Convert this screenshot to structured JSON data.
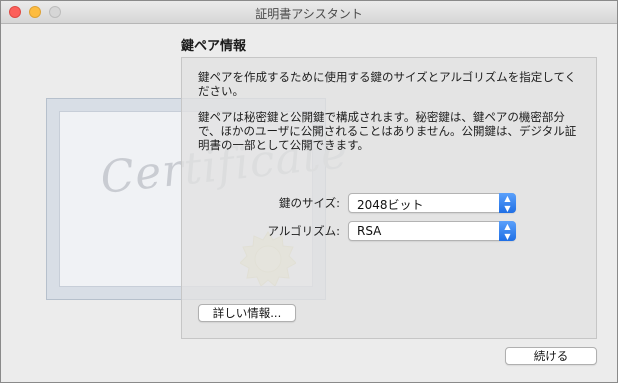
{
  "window": {
    "title": "証明書アシスタント"
  },
  "certificate_art": {
    "script_text": "Certificate"
  },
  "section": {
    "title": "鍵ペア情報"
  },
  "description": {
    "paragraph1": "鍵ペアを作成するために使用する鍵のサイズとアルゴリズムを指定してください。",
    "paragraph2": "鍵ペアは秘密鍵と公開鍵で構成されます。秘密鍵は、鍵ペアの機密部分で、ほかのユーザに公開されることはありません。公開鍵は、デジタル証明書の一部として公開できます。"
  },
  "fields": {
    "key_size": {
      "label": "鍵のサイズ:",
      "value": "2048ビット"
    },
    "algorithm": {
      "label": "アルゴリズム:",
      "value": "RSA"
    }
  },
  "buttons": {
    "more_info": "詳しい情報...",
    "continue": "続ける"
  },
  "colors": {
    "accent": "#1f6fe5",
    "close": "#fc605b",
    "minimize": "#fdbc40",
    "zoom": "#d6d6d6"
  }
}
